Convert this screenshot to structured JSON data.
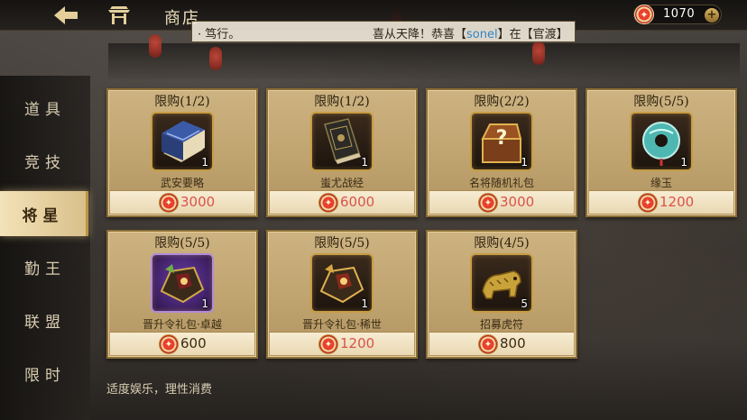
{
  "header": {
    "title": "商店",
    "currency": {
      "value": "1070",
      "plus": "+"
    }
  },
  "broadcast": {
    "prefix": "· 笃行。",
    "message_before": "喜从天降！恭喜【",
    "player": "sonel",
    "message_after": "】在【官渡】"
  },
  "sidebar": {
    "items": [
      {
        "label": "道具",
        "active": false
      },
      {
        "label": "竞技",
        "active": false
      },
      {
        "label": "将星",
        "active": true
      },
      {
        "label": "勤王",
        "active": false
      },
      {
        "label": "联盟",
        "active": false
      },
      {
        "label": "限时",
        "active": false
      }
    ]
  },
  "shop": {
    "items": [
      {
        "limit": "限购(1/2)",
        "name": "武安要略",
        "qty": "1",
        "price": "3000",
        "affordable": false,
        "icon": "blue-book-icon"
      },
      {
        "limit": "限购(1/2)",
        "name": "蚩尤战经",
        "qty": "1",
        "price": "6000",
        "affordable": false,
        "icon": "dark-book-icon"
      },
      {
        "limit": "限购(2/2)",
        "name": "名将随机礼包",
        "qty": "1",
        "price": "3000",
        "affordable": false,
        "icon": "mystery-chest-icon"
      },
      {
        "limit": "限购(5/5)",
        "name": "缘玉",
        "qty": "1",
        "price": "1200",
        "affordable": false,
        "icon": "jade-disc-icon"
      },
      {
        "limit": "限购(5/5)",
        "name": "晋升令礼包·卓越",
        "qty": "1",
        "price": "600",
        "affordable": true,
        "icon": "purple-token-pack-icon"
      },
      {
        "limit": "限购(5/5)",
        "name": "晋升令礼包·稀世",
        "qty": "1",
        "price": "1200",
        "affordable": false,
        "icon": "gold-token-pack-icon"
      },
      {
        "limit": "限购(4/5)",
        "name": "招募虎符",
        "qty": "5",
        "price": "800",
        "affordable": true,
        "icon": "tiger-tally-icon"
      }
    ]
  },
  "footer": {
    "note": "适度娱乐，理性消费"
  },
  "colors": {
    "price_short": "#d9534a",
    "price_ok": "#3a2b14",
    "player": "#2f86c7"
  }
}
